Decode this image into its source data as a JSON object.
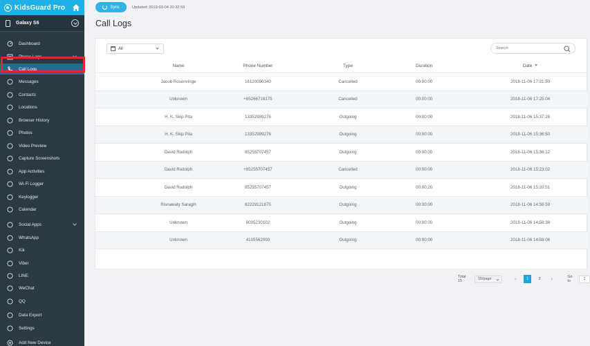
{
  "app": {
    "brand": "KidsGuard Pro",
    "device_name": "Galaxy S6"
  },
  "colors": {
    "brand": "#1fb1e6",
    "sidebar_bg": "#2b3a42",
    "active_item": "#1f6f8b",
    "highlight_outline": "#e3262b",
    "page_current": "#1fa3dd",
    "cancelled_call": "#e0504a",
    "outgoing_call": "#3a6fb5"
  },
  "sidebar": {
    "items": [
      {
        "label": "Dashboard",
        "icon": "dashboard-icon"
      },
      {
        "label": "Phone Logs",
        "icon": "list-icon",
        "expandable": true
      },
      {
        "label": "Call Logs",
        "icon": "phone-icon",
        "active": true
      },
      {
        "label": "Messages",
        "icon": "message-icon"
      },
      {
        "label": "Contacts",
        "icon": "contacts-icon"
      },
      {
        "label": "Locations",
        "icon": "location-icon"
      },
      {
        "label": "Browser History",
        "icon": "globe-icon"
      },
      {
        "label": "Photos",
        "icon": "photo-icon"
      },
      {
        "label": "Video Preview",
        "icon": "video-icon"
      },
      {
        "label": "Capture Screenshots",
        "icon": "screenshot-icon"
      },
      {
        "label": "App Activities",
        "icon": "app-activity-icon"
      },
      {
        "label": "Wi-Fi Logger",
        "icon": "wifi-icon"
      },
      {
        "label": "Keylogger",
        "icon": "keyboard-icon"
      },
      {
        "label": "Calendar",
        "icon": "calendar-icon"
      },
      {
        "label": "Social Apps",
        "icon": "chat-icon",
        "expandable": true
      },
      {
        "label": "WhatsApp",
        "icon": "whatsapp-icon"
      },
      {
        "label": "Kik",
        "icon": "kik-icon"
      },
      {
        "label": "Viber",
        "icon": "viber-icon"
      },
      {
        "label": "LINE",
        "icon": "line-icon"
      },
      {
        "label": "WeChat",
        "icon": "wechat-icon"
      },
      {
        "label": "QQ",
        "icon": "qq-icon"
      },
      {
        "label": "Data Export",
        "icon": "export-icon"
      },
      {
        "label": "Settings",
        "icon": "settings-icon"
      },
      {
        "label": "Add New Device",
        "icon": "plus-icon"
      }
    ]
  },
  "topbar": {
    "sync_label": "Sync",
    "updated_text": "Updated: 2019-03-04 20:32:59"
  },
  "page": {
    "title": "Call Logs"
  },
  "filter": {
    "selected": "All"
  },
  "search": {
    "placeholder": "Search"
  },
  "table": {
    "headers": {
      "name": "Name",
      "phone": "Phone Number",
      "type": "Type",
      "duration": "Duration",
      "date": "Date"
    },
    "rows": [
      {
        "status": "cancelled",
        "name": "Jacob Rosenvinge",
        "phone": "16120090340",
        "type": "Cancelled",
        "duration": "00:00:00",
        "date": "2018-11-06 17:31:50"
      },
      {
        "status": "cancelled",
        "name": "Unknown",
        "phone": "+85266716175",
        "type": "Cancelled",
        "duration": "00:00:00",
        "date": "2018-11-06 17:25:04"
      },
      {
        "status": "outgoing",
        "name": "H. K. Skip Pita",
        "phone": "13352989276",
        "type": "Outgoing",
        "duration": "00:00:00",
        "date": "2018-11-06 15:37:28"
      },
      {
        "status": "outgoing",
        "name": "H. K. Skip Pita",
        "phone": "13352989276",
        "type": "Outgoing",
        "duration": "00:00:00",
        "date": "2018-11-06 15:36:50"
      },
      {
        "status": "outgoing",
        "name": "David Rudolph",
        "phone": "85255707457",
        "type": "Outgoing",
        "duration": "00:00:00",
        "date": "2018-11-06 15:36:12"
      },
      {
        "status": "cancelled",
        "name": "David Rudolph",
        "phone": "+85255707457",
        "type": "Cancelled",
        "duration": "00:00:00",
        "date": "2018-11-06 15:23:02"
      },
      {
        "status": "outgoing",
        "name": "David Rudolph",
        "phone": "85255707457",
        "type": "Outgoing",
        "duration": "00:00:20",
        "date": "2018-11-06 15:20:51"
      },
      {
        "status": "outgoing",
        "name": "Risnawaty Saragih",
        "phone": "62229121875",
        "type": "Outgoing",
        "duration": "00:00:00",
        "date": "2018-11-06 14:58:59"
      },
      {
        "status": "outgoing",
        "name": "Unknown",
        "phone": "8005230102",
        "type": "Outgoing",
        "duration": "00:00:00",
        "date": "2018-11-06 14:58:36"
      },
      {
        "status": "outgoing",
        "name": "Unknown",
        "phone": "4105562000",
        "type": "Outgoing",
        "duration": "00:00:00",
        "date": "2018-11-06 14:58:06"
      }
    ]
  },
  "pagination": {
    "total": "Total 15",
    "per_page": "10/page",
    "prev": "‹",
    "next": "›",
    "pages": [
      "1",
      "2"
    ],
    "current_page": "1",
    "goto_label": "Go to",
    "goto_value": "1"
  }
}
